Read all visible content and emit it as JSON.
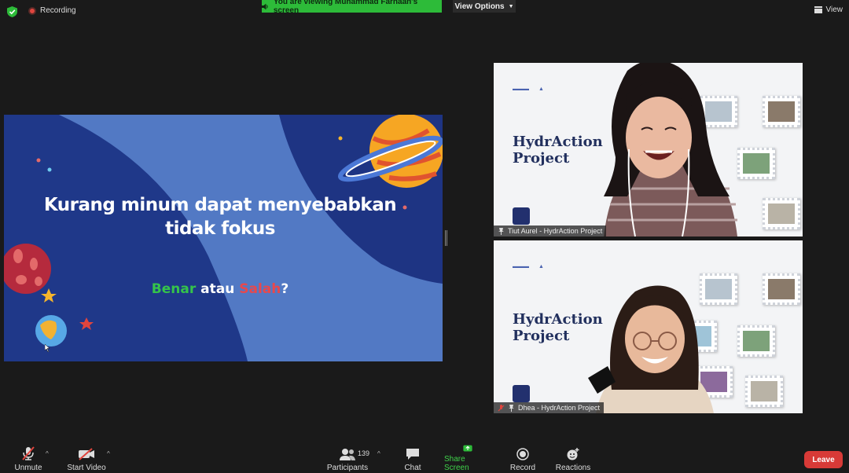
{
  "top_bar": {
    "recording_label": "Recording",
    "viewing_banner": "You are viewing Muhammad Farhaan's screen",
    "view_options_label": "View Options",
    "view_label": "View"
  },
  "shared_slide": {
    "title": "Kurang minum dapat menyebabkan tidak fokus",
    "answer_true": "Benar",
    "answer_join": " atau ",
    "answer_false": "Salah",
    "answer_end": "?"
  },
  "participants": [
    {
      "name_label": "Tiut Aurel - HydrAction Project",
      "background_title_1": "HydrAction",
      "background_title_2": "Project",
      "muted": false
    },
    {
      "name_label": "Dhea - HydrAction Project",
      "background_title_1": "HydrAction",
      "background_title_2": "Project",
      "muted": true
    }
  ],
  "toolbar": {
    "unmute_label": "Unmute",
    "start_video_label": "Start Video",
    "participants_label": "Participants",
    "participants_count": "139",
    "chat_label": "Chat",
    "share_screen_label": "Share Screen",
    "record_label": "Record",
    "reactions_label": "Reactions",
    "leave_label": "Leave"
  },
  "colors": {
    "share_green": "#2dbb39",
    "leave_red": "#d83a37",
    "slide_blue": "#253f95"
  }
}
